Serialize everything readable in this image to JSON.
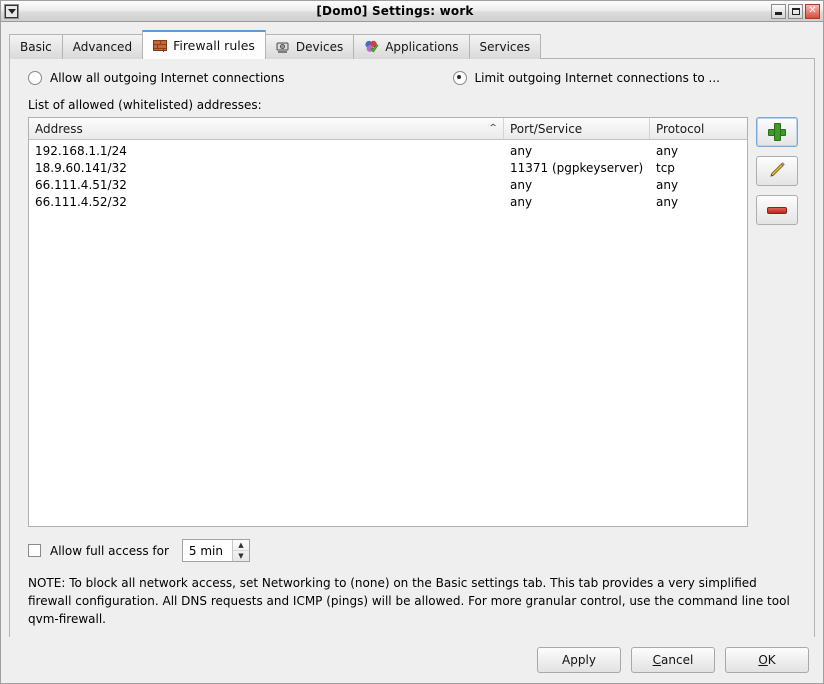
{
  "window": {
    "title": "[Dom0] Settings: work",
    "menu_icon": "window-menu-icon",
    "minimize_label": "",
    "maximize_label": "",
    "close_label": "✕"
  },
  "tabs": [
    {
      "label": "Basic",
      "icon": "",
      "active": false
    },
    {
      "label": "Advanced",
      "icon": "",
      "active": false
    },
    {
      "label": "Firewall rules",
      "icon": "firewall-brick-icon",
      "active": true
    },
    {
      "label": "Devices",
      "icon": "devices-icon",
      "active": false
    },
    {
      "label": "Applications",
      "icon": "applications-icon",
      "active": false
    },
    {
      "label": "Services",
      "icon": "",
      "active": false
    }
  ],
  "firewall": {
    "options": [
      {
        "label": "Allow all outgoing Internet connections",
        "selected": false
      },
      {
        "label": "Limit outgoing Internet connections to ...",
        "selected": true
      }
    ],
    "list_label": "List of allowed (whitelisted) addresses:",
    "columns": [
      "Address",
      "Port/Service",
      "Protocol"
    ],
    "sort_indicator": "⌃",
    "rows": [
      {
        "address": "192.168.1.1/24",
        "port": "any",
        "protocol": "any"
      },
      {
        "address": "18.9.60.141/32",
        "port": "11371 (pgpkeyserver)",
        "protocol": "tcp"
      },
      {
        "address": "66.111.4.51/32",
        "port": "any",
        "protocol": "any"
      },
      {
        "address": "66.111.4.52/32",
        "port": "any",
        "protocol": "any"
      }
    ],
    "side_buttons": [
      {
        "name": "add-rule-button",
        "icon": "plus-icon",
        "focused": true
      },
      {
        "name": "edit-rule-button",
        "icon": "pencil-icon",
        "focused": false
      },
      {
        "name": "remove-rule-button",
        "icon": "minus-icon",
        "focused": false
      }
    ],
    "full_access": {
      "label": "Allow full access for",
      "checked": false,
      "duration_value": "5 min"
    },
    "note": "NOTE:  To block all network access, set Networking to (none) on the Basic settings tab. This tab provides a very simplified firewall configuration. All DNS requests and ICMP (pings) will be allowed. For more granular control, use the command line tool qvm-firewall."
  },
  "footer": {
    "apply": "Apply",
    "cancel_prefix": "",
    "cancel_accel": "C",
    "cancel_suffix": "ancel",
    "ok_accel": "O",
    "ok_suffix": "K"
  },
  "colors": {
    "accent_tab": "#5b9dd9",
    "add_green": "#3f9b29",
    "remove_red": "#b32b1e",
    "firewall_orange": "#c4653a",
    "close_red": "#d94b3c"
  }
}
